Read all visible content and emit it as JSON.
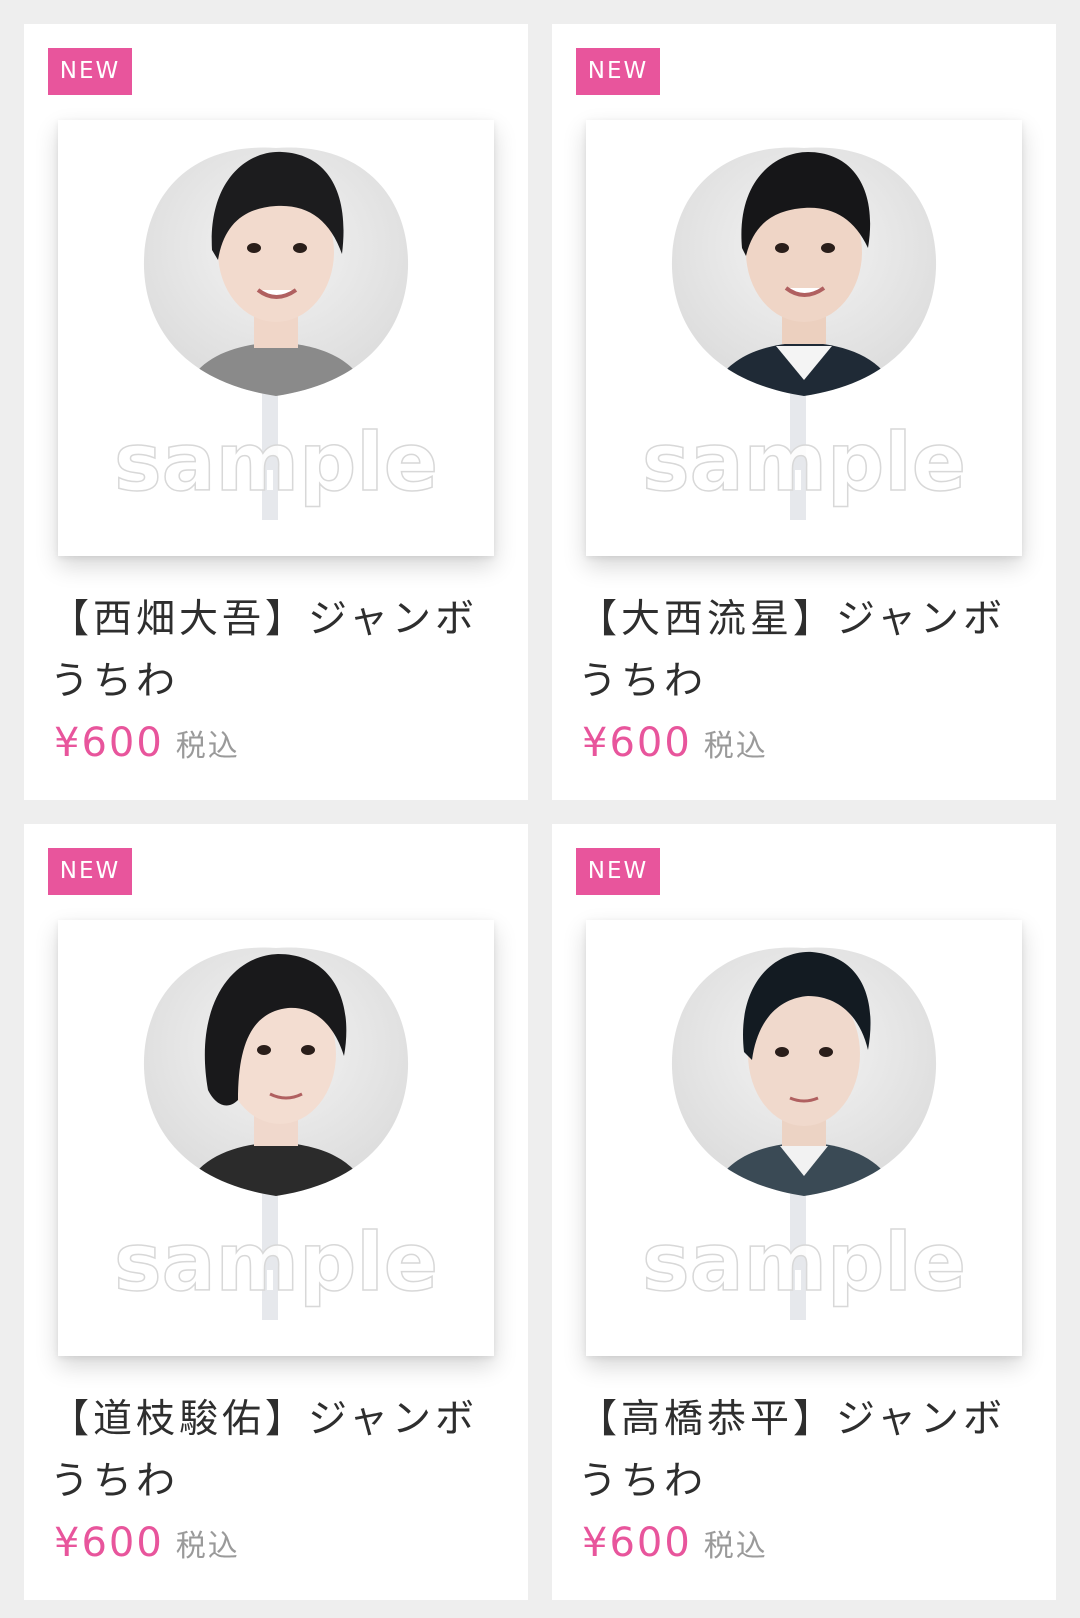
{
  "products": [
    {
      "badge": "NEW",
      "title": "【西畑大吾】ジャンボうちわ",
      "price": "¥600",
      "tax_label": "税込",
      "watermark": "sample",
      "shirt_color": "#8a8a8a"
    },
    {
      "badge": "NEW",
      "title": "【大西流星】ジャンボうちわ",
      "price": "¥600",
      "tax_label": "税込",
      "watermark": "sample",
      "shirt_color": "#1f2a36"
    },
    {
      "badge": "NEW",
      "title": "【道枝駿佑】ジャンボうちわ",
      "price": "¥600",
      "tax_label": "税込",
      "watermark": "sample",
      "shirt_color": "#2b2b2b"
    },
    {
      "badge": "NEW",
      "title": "【高橋恭平】ジャンボうちわ",
      "price": "¥600",
      "tax_label": "税込",
      "watermark": "sample",
      "shirt_color": "#3a4a55"
    }
  ],
  "colors": {
    "accent": "#e8559c",
    "background": "#eeeeee",
    "card": "#ffffff",
    "text": "#2e2e2e",
    "muted": "#9a9a9a"
  }
}
